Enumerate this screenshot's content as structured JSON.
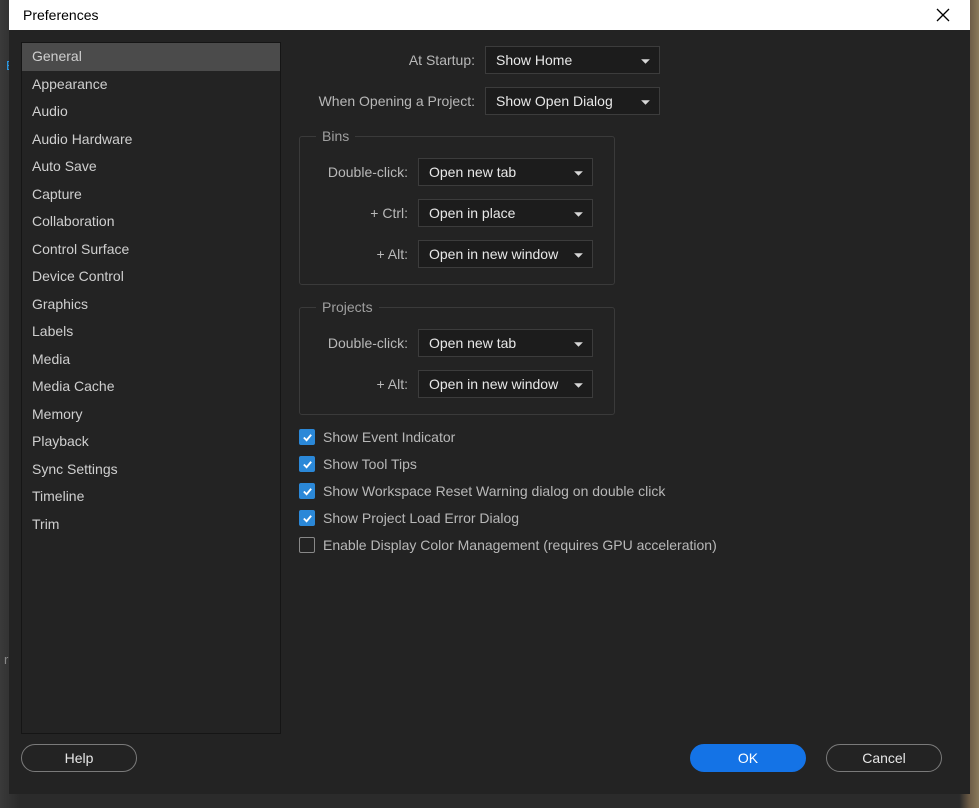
{
  "window": {
    "title": "Preferences"
  },
  "sidebar": {
    "selectedIndex": 0,
    "items": [
      "General",
      "Appearance",
      "Audio",
      "Audio Hardware",
      "Auto Save",
      "Capture",
      "Collaboration",
      "Control Surface",
      "Device Control",
      "Graphics",
      "Labels",
      "Media",
      "Media Cache",
      "Memory",
      "Playback",
      "Sync Settings",
      "Timeline",
      "Trim"
    ]
  },
  "content": {
    "startup": {
      "label": "At Startup:",
      "value": "Show Home"
    },
    "openProject": {
      "label": "When Opening a Project:",
      "value": "Show Open Dialog"
    },
    "bins": {
      "legend": "Bins",
      "doubleClick": {
        "label": "Double-click:",
        "value": "Open new tab"
      },
      "ctrl": {
        "label": "+ Ctrl:",
        "value": "Open in place"
      },
      "alt": {
        "label": "+ Alt:",
        "value": "Open in new window"
      }
    },
    "projects": {
      "legend": "Projects",
      "doubleClick": {
        "label": "Double-click:",
        "value": "Open new tab"
      },
      "alt": {
        "label": "+ Alt:",
        "value": "Open in new window"
      }
    },
    "checks": {
      "eventIndicator": {
        "checked": true,
        "label": "Show Event Indicator"
      },
      "toolTips": {
        "checked": true,
        "label": "Show Tool Tips"
      },
      "workspaceReset": {
        "checked": true,
        "label": "Show Workspace Reset Warning dialog on double click"
      },
      "projectLoadError": {
        "checked": true,
        "label": "Show Project Load Error Dialog"
      },
      "colorManagement": {
        "checked": false,
        "label": "Enable Display Color Management (requires GPU acceleration)"
      }
    }
  },
  "footer": {
    "help": "Help",
    "ok": "OK",
    "cancel": "Cancel"
  },
  "backdrop": {
    "b": "B",
    "r": "r"
  }
}
